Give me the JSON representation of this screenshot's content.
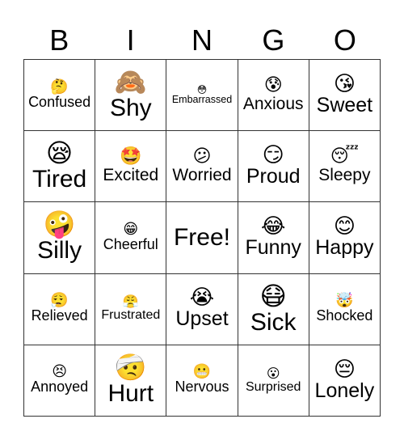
{
  "header": {
    "letters": [
      "B",
      "I",
      "N",
      "G",
      "O"
    ]
  },
  "cells": [
    {
      "label": "Confused",
      "emoji": "🤔",
      "emoji_name": "thinking-face",
      "size": "s-s"
    },
    {
      "label": "Shy",
      "emoji": "🙈",
      "emoji_name": "face-covering-eyes",
      "size": "s-xl"
    },
    {
      "label": "Embarrassed",
      "emoji": "😳",
      "emoji_name": "flushed-face",
      "size": "s-xxs"
    },
    {
      "label": "Anxious",
      "emoji": "😰",
      "emoji_name": "anxious-sweat-face",
      "size": "s-m"
    },
    {
      "label": "Sweet",
      "emoji": "😘",
      "emoji_name": "kissing-face",
      "size": "s-l"
    },
    {
      "label": "Tired",
      "emoji": "😪",
      "emoji_name": "sleepy-snot-face",
      "size": "s-xl"
    },
    {
      "label": "Excited",
      "emoji": "🤩",
      "emoji_name": "star-struck-face",
      "size": "s-m"
    },
    {
      "label": "Worried",
      "emoji": "😕",
      "emoji_name": "confused-face",
      "size": "s-m"
    },
    {
      "label": "Proud",
      "emoji": "😏",
      "emoji_name": "smirking-face",
      "size": "s-l"
    },
    {
      "label": "Sleepy",
      "emoji": "😴",
      "emoji_name": "sleeping-face",
      "size": "s-m"
    },
    {
      "label": "Silly",
      "emoji": "🤪",
      "emoji_name": "zany-face",
      "size": "s-xl"
    },
    {
      "label": "Cheerful",
      "emoji": "😁",
      "emoji_name": "beaming-face",
      "size": "s-s"
    },
    {
      "label": "Free!",
      "emoji": "",
      "emoji_name": "",
      "size": "free",
      "free": true
    },
    {
      "label": "Funny",
      "emoji": "😂",
      "emoji_name": "tears-of-joy-face",
      "size": "s-l"
    },
    {
      "label": "Happy",
      "emoji": "😊",
      "emoji_name": "smiling-face",
      "size": "s-l"
    },
    {
      "label": "Relieved",
      "emoji": "😮‍💨",
      "emoji_name": "exhaling-face",
      "size": "s-s"
    },
    {
      "label": "Frustrated",
      "emoji": "😤",
      "emoji_name": "steam-from-nose-face",
      "size": "s-xs"
    },
    {
      "label": "Upset",
      "emoji": "😭",
      "emoji_name": "loudly-crying-face",
      "size": "s-l"
    },
    {
      "label": "Sick",
      "emoji": "😷",
      "emoji_name": "medical-mask-face",
      "size": "s-xl"
    },
    {
      "label": "Shocked",
      "emoji": "🤯",
      "emoji_name": "exploding-head",
      "size": "s-s"
    },
    {
      "label": "Annoyed",
      "emoji": "😣",
      "emoji_name": "persevering-face",
      "size": "s-s"
    },
    {
      "label": "Hurt",
      "emoji": "🤕",
      "emoji_name": "head-bandage-face",
      "size": "s-xl"
    },
    {
      "label": "Nervous",
      "emoji": "😬",
      "emoji_name": "grimacing-face",
      "size": "s-s"
    },
    {
      "label": "Surprised",
      "emoji": "😮",
      "emoji_name": "open-mouth-face",
      "size": "s-xs"
    },
    {
      "label": "Lonely",
      "emoji": "😔",
      "emoji_name": "pensive-face",
      "size": "s-l"
    }
  ]
}
